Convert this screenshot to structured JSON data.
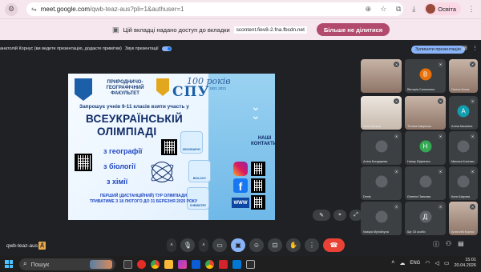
{
  "browser": {
    "url_host": "meet.google.com",
    "url_path": "/qwb-teaz-aus?pli=1&authuser=1",
    "profile_name": "Освіта"
  },
  "share_bar": {
    "message": "Цій вкладці надано доступ до вкладки",
    "shared_url": "scontent.fiev8-2.fna.fbcdn.net",
    "stop_label": "Більше не ділитися"
  },
  "meet": {
    "presenter_text": "анатолій Корнус (ви ведете презентацію, додаєте примітки)",
    "sound_label": "Звук презентації",
    "stop_presenting_label": "Зупинити презентацію",
    "meeting_code": "qwb-teaz-aus",
    "meeting_badge": "Д"
  },
  "slide": {
    "faculty": "ПРИРОДНИЧО-ГЕОГРАФІЧНИЙ ФАКУЛЬТЕТ",
    "years_label": "100 років",
    "university": "СПУ",
    "year_range": "1921 2021",
    "invite": "Запрошує учнів 9-11 класів взяти участь у",
    "title_line1": "ВСЕУКРАЇНСЬКІЙ",
    "title_line2": "ОЛІМПІАДІ",
    "subject_geo": "з географії",
    "subject_bio": "з біології",
    "subject_chem": "з хімії",
    "contacts": "НАШІ КОНТАКТИ:",
    "www": "WWW",
    "round_line1": "ПЕРШИЙ (ДИСТАНЦІЙНИЙ) ТУР ОЛІМПІАДИ",
    "round_line2": "ТРИВАТИМЕ З 18 ЛЮТОГО ДО 31 БЕРЕЗНЯ 2025 РОКУ",
    "card_geo": "GEOGRAPHY",
    "card_bio": "BIOLOGY",
    "card_chem": "CHEMISTRY"
  },
  "participants": [
    {
      "name": "",
      "initial": "",
      "color": "#c8b4a8",
      "camera": true
    },
    {
      "name": "Вікторія Солоненко",
      "initial": "В",
      "color": "#e8710a",
      "camera": false
    },
    {
      "name": "Олена Котик",
      "initial": "",
      "color": "#3c4043",
      "camera": true
    },
    {
      "name": "Анна Шкарів",
      "initial": "",
      "color": "#8d7466",
      "camera": true
    },
    {
      "name": "Тетяна Закірська",
      "initial": "",
      "color": "#b39b8e",
      "camera": true
    },
    {
      "name": "Аліна Касаніна",
      "initial": "А",
      "color": "#129eaf",
      "camera": false
    },
    {
      "name": "Аліна Бондарева",
      "initial": "",
      "color": "#3c4043",
      "camera": false
    },
    {
      "name": "Назар Юдіненко",
      "initial": "Н",
      "color": "#34a853",
      "camera": false
    },
    {
      "name": "Микола Косенко",
      "initial": "",
      "color": "#3c4043",
      "camera": false
    },
    {
      "name": "Denis",
      "initial": "",
      "color": "#3c4043",
      "camera": false
    },
    {
      "name": "Євгенія Панкова",
      "initial": "",
      "color": "#3c4043",
      "camera": false
    },
    {
      "name": "Катя Шарова",
      "initial": "",
      "color": "#3c4043",
      "camera": false
    },
    {
      "name": "Nastya Mylnikhyna",
      "initial": "",
      "color": "#3c4043",
      "camera": false
    },
    {
      "name": "Ще 33 особи",
      "initial": "Д",
      "color": "#5f6368",
      "camera": false
    },
    {
      "name": "Анатолій Корнус",
      "initial": "",
      "color": "#c7b9ad",
      "camera": true
    }
  ],
  "taskbar": {
    "search_placeholder": "Пошук",
    "lang": "ENG",
    "time": "15:01",
    "date": "20.04.2026"
  }
}
